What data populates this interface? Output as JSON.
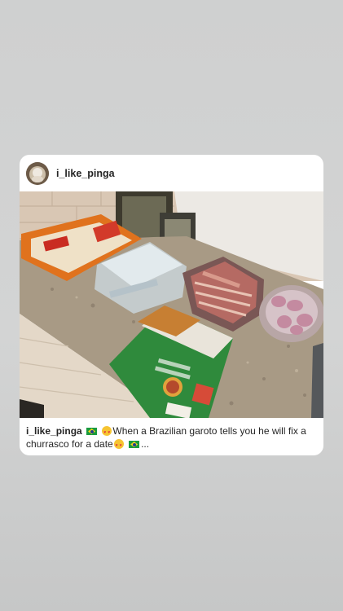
{
  "post": {
    "username": "i_like_pinga",
    "caption_user": "i_like_pinga",
    "caption_text_1": "When a Brazilian garoto tells you he will fix",
    "caption_text_2": "a churrasco for a date",
    "caption_more": "..."
  },
  "icons": {
    "flag": "brazil-flag-icon",
    "emoji": "heart-eyes-emoji-icon"
  },
  "colors": {
    "background": "#d0d1d1",
    "card": "#ffffff",
    "text": "#262626"
  }
}
